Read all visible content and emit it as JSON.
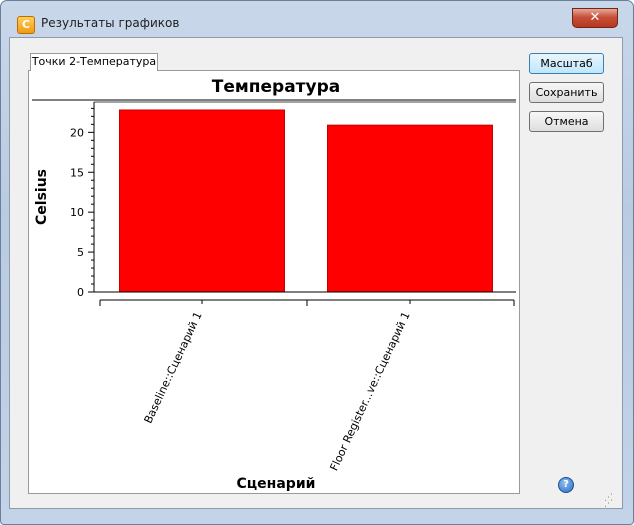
{
  "window": {
    "title": "Результаты графиков",
    "app_icon_letter": "C",
    "close_label": "✕"
  },
  "tabs": [
    {
      "label": "Точки 2-Температура",
      "selected": true
    }
  ],
  "buttons": {
    "scale": "Масштаб",
    "save": "Сохранить",
    "cancel": "Отмена"
  },
  "icons": {
    "help": "help-icon",
    "close": "close-icon",
    "resize": "resize-grip-icon"
  },
  "colors": {
    "bar": "#ff0000",
    "bar_edge": "#c80000"
  },
  "chart_data": {
    "type": "bar",
    "title": "Температура",
    "xlabel": "Сценарий",
    "ylabel": "Celsius",
    "categories": [
      "Baseline::Сценарий 1",
      "Floor Register...ve::Сценарий 1"
    ],
    "values": [
      22.8,
      20.9
    ],
    "ylim": [
      0,
      23.8
    ],
    "yticks": [
      0,
      5,
      10,
      15,
      20
    ],
    "grid": false,
    "legend": "none"
  }
}
